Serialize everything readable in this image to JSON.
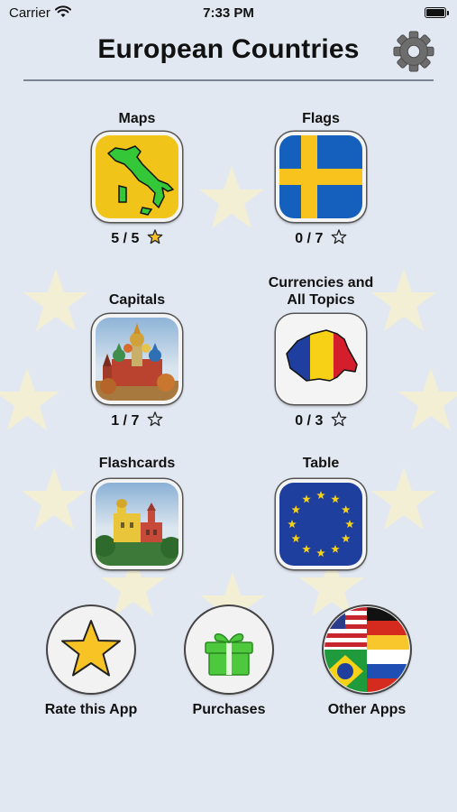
{
  "status_bar": {
    "carrier": "Carrier",
    "time": "7:33 PM"
  },
  "header": {
    "title": "European Countries"
  },
  "tiles": [
    {
      "label": "Maps",
      "score": "5 / 5",
      "icon": "italy-map-icon",
      "star_filled": true
    },
    {
      "label": "Flags",
      "score": "0 / 7",
      "icon": "sweden-flag-icon",
      "star_filled": false
    },
    {
      "label": "Capitals",
      "score": "1 / 7",
      "icon": "kremlin-photo-icon",
      "star_filled": false
    },
    {
      "label": "Currencies and\nAll Topics",
      "score": "0 / 3",
      "icon": "romania-map-icon",
      "star_filled": false
    },
    {
      "label": "Flashcards",
      "icon": "pena-palace-photo-icon"
    },
    {
      "label": "Table",
      "icon": "eu-flag-icon"
    }
  ],
  "bottom_buttons": [
    {
      "label": "Rate this App",
      "icon": "star-icon"
    },
    {
      "label": "Purchases",
      "icon": "gift-icon"
    },
    {
      "label": "Other Apps",
      "icon": "flags-collage-icon"
    }
  ],
  "colors": {
    "background": "#e2e8f2",
    "star_gold": "#f7c325",
    "eu_blue": "#1e3f9e"
  }
}
